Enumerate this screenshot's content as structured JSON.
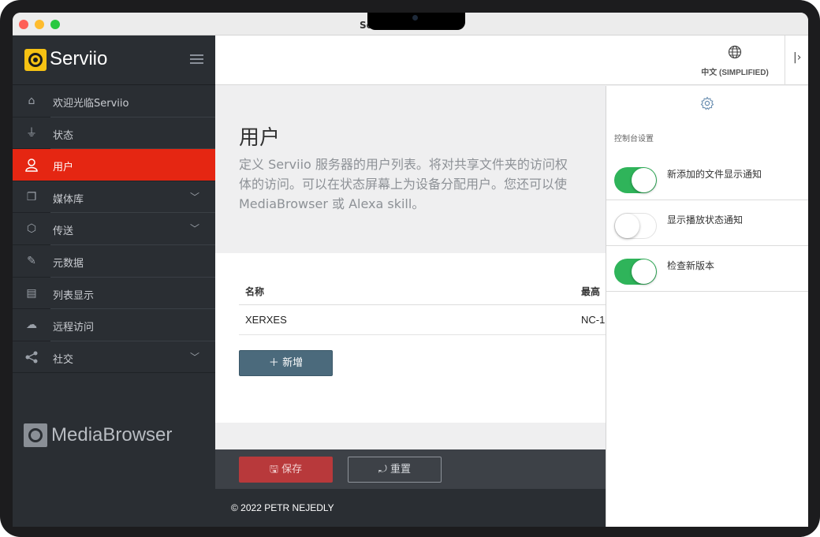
{
  "window": {
    "title": "Serviio 控制台"
  },
  "brand": {
    "name": "Serviio",
    "logo_icon": "serviio-logo-icon",
    "color": "#f6c213"
  },
  "sidebar": {
    "items": [
      {
        "label": "欢迎光临Serviio",
        "icon": "home-icon"
      },
      {
        "label": "状态",
        "icon": "plug-icon"
      },
      {
        "label": "用户",
        "icon": "user-icon",
        "active": true
      },
      {
        "label": "媒体库",
        "icon": "copy-icon",
        "expandable": true
      },
      {
        "label": "传送",
        "icon": "cube-icon",
        "expandable": true
      },
      {
        "label": "元数据",
        "icon": "edit-icon"
      },
      {
        "label": "列表显示",
        "icon": "list-icon"
      },
      {
        "label": "远程访问",
        "icon": "cloud-icon"
      },
      {
        "label": "社交",
        "icon": "share-icon",
        "expandable": true
      }
    ],
    "partner": {
      "name": "MediaBrowser"
    },
    "active_color": "#e52612"
  },
  "header": {
    "language": "中文 (SIMPLIFIED)"
  },
  "main": {
    "title": "用户",
    "description_lines": [
      "定义 Serviio 服务器的用户列表。将对共享文件夹的访问权",
      "体的访问。可以在状态屏幕上为设备分配用户。您还可以使",
      "MediaBrowser 或 Alexa skill。"
    ],
    "table": {
      "headers": [
        "名称",
        "最高"
      ],
      "rows": [
        [
          "XERXES",
          "NC-1"
        ]
      ]
    },
    "add_label": "新增",
    "save_label": "保存",
    "reset_label": "重置",
    "footer": "© 2022 PETR NEJEDLY"
  },
  "settings_panel": {
    "title": "控制台设置",
    "settings": [
      {
        "label": "新添加的文件显示通知",
        "on": true
      },
      {
        "label": "显示播放状态通知",
        "on": false
      },
      {
        "label": "检查新版本",
        "on": true
      }
    ],
    "toggle_on_color": "#2fb45a"
  }
}
